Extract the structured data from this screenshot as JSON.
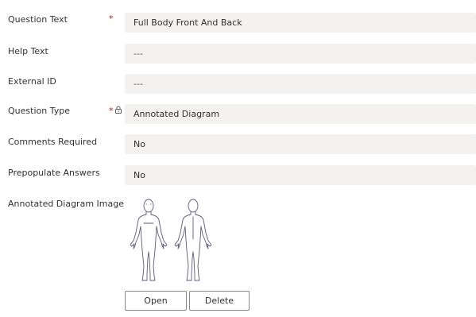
{
  "fields": [
    {
      "label": "Question Text",
      "value": "Full Body Front And Back",
      "required": true,
      "locked": false
    },
    {
      "label": "Help Text",
      "value": "---",
      "required": false,
      "locked": false
    },
    {
      "label": "External ID",
      "value": "---",
      "required": false,
      "locked": false
    },
    {
      "label": "Question Type",
      "value": "Annotated Diagram",
      "required": true,
      "locked": true
    },
    {
      "label": "Comments Required",
      "value": "No",
      "required": false,
      "locked": false
    },
    {
      "label": "Prepopulate Answers",
      "value": "No",
      "required": false,
      "locked": false
    }
  ],
  "required_marker": "*",
  "lock_icon": "lock-icon",
  "diagram": {
    "label": "Annotated Diagram Image",
    "image_icon": "full-body-front-back-icon",
    "open_label": "Open",
    "delete_label": "Delete"
  },
  "colors": {
    "required": "#a4262c",
    "field_bg": "#f3f2f1",
    "diagram_stroke": "#5a5a7a"
  }
}
